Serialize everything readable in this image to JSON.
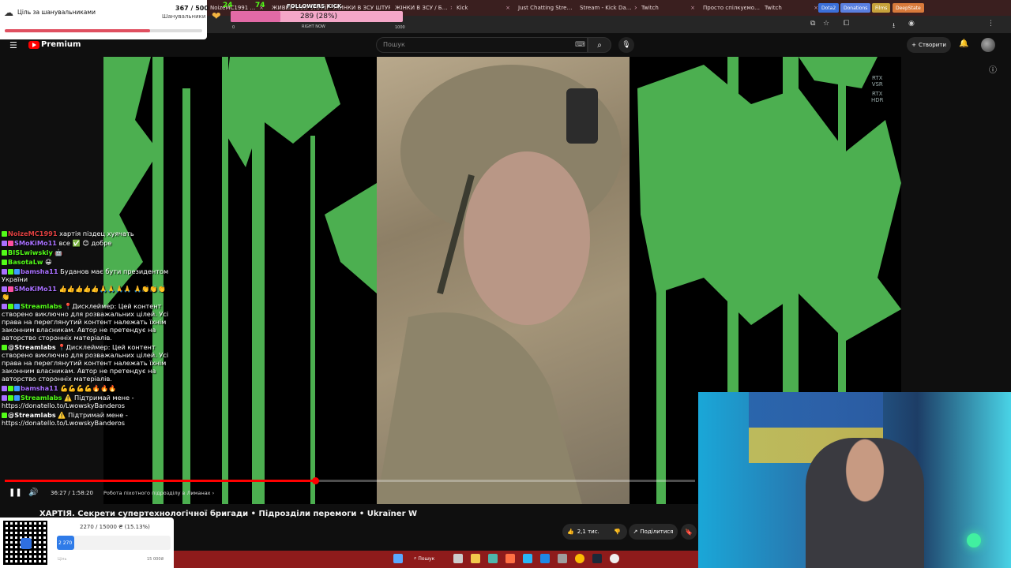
{
  "browser": {
    "tabs": [
      {
        "title": "NoizeMC1991 …",
        "color": "#3a1f1f"
      },
      {
        "title": "ЖИВИЙ ЕФІР УКРАЇНСЬКИЙ ДІ…"
      },
      {
        "title": "ЖИНКИ В ЗСУ ШТУРМ…"
      },
      {
        "title": "ЖІНКИ В ЗСУ / Б…"
      },
      {
        "title": "Kick"
      },
      {
        "title": "Just Chatting Stre…"
      },
      {
        "title": "Stream - Kick Da…"
      },
      {
        "title": "Twitch"
      },
      {
        "title": "Просто спілкуємо…"
      },
      {
        "title": "Twitch"
      }
    ],
    "bookmarks": [
      {
        "label": "Dota2",
        "color": "#3b6fd9"
      },
      {
        "label": "Donations",
        "color": "#5a7fe0"
      },
      {
        "label": "Films",
        "color": "#c8a23b"
      },
      {
        "label": "DeepState",
        "color": "#d97a3b"
      }
    ]
  },
  "youtube": {
    "logo_label": "Premium",
    "search_placeholder": "Пошук",
    "create_label": "Створити",
    "video_title": "ХАРТІЯ. Секрети супертехнологічної бригади • Підрозділи перемоги • Ukraïner W",
    "time": "36:27 / 1:58:20",
    "chapter": "Робота піхотного підрозділу в Лиманах ›",
    "progress_fraction": 0.45,
    "likes": "2,1 тис.",
    "share_label": "Поділитися",
    "rtx_badge": [
      "RTX",
      "VSR",
      "RTX",
      "HDR"
    ]
  },
  "goal_widget": {
    "title": "Ціль за шанувальниками",
    "count": "367 / 500",
    "subtitle": "Шанувальники",
    "progress_fraction": 0.734
  },
  "followers_widget": {
    "title": "FOLLOWERS KICK",
    "count": "289 (28%)",
    "left_label": "0",
    "now_label": "RIGHT NOW",
    "max_label": "1000",
    "progress_fraction": 0.289,
    "stat1": "24",
    "stat2": "74"
  },
  "chat": [
    {
      "user": "NoizeMC1991",
      "user_color": "#e04040",
      "text": "хартія піздец хуячать",
      "badges": [
        "#53fc18"
      ]
    },
    {
      "user": "SMoKiMo11",
      "user_color": "#a970ff",
      "text": "все ✅ 😊 добре",
      "badges": [
        "#a970ff",
        "#ff4fa0"
      ]
    },
    {
      "user": "BISLwiwskiy",
      "user_color": "#53fc18",
      "text": "🤖",
      "badges": [
        "#53fc18"
      ]
    },
    {
      "user": "BasotaLw",
      "user_color": "#53fc18",
      "text": "😀",
      "badges": [
        "#53fc18"
      ]
    },
    {
      "user": "bamsha11",
      "user_color": "#a970ff",
      "text": "Буданов має бути президентом України",
      "badges": [
        "#a970ff",
        "#53fc18",
        "#3b9cff"
      ]
    },
    {
      "user": "SMoKiMo11",
      "user_color": "#a970ff",
      "text": "👍👍👍👍👍🙏🙏🙏🙏 🙏👏👏👏👏",
      "badges": [
        "#a970ff",
        "#ff4fa0"
      ]
    },
    {
      "user": "Streamlabs",
      "user_color": "#53fc18",
      "text": "📍Дисклеймер: Цей контент створено виключно для розважальних цілей. Усі права на переглянутий контент належать їхнім законним власникам. Автор не претендує на авторство сторонніх матеріалів.",
      "badges": [
        "#a970ff",
        "#53fc18",
        "#3b9cff"
      ]
    },
    {
      "user": "@Streamlabs",
      "user_color": "#fff",
      "text": "📍Дисклеймер: Цей контент створено виключно для розважальних цілей. Усі права на переглянутий контент належать їхнім законним власникам. Автор не претендує на авторство сторонніх матеріалів.",
      "badges": [
        "#53fc18"
      ]
    },
    {
      "user": "bamsha11",
      "user_color": "#a970ff",
      "text": "💪💪💪💪🔥🔥🔥",
      "badges": [
        "#a970ff",
        "#53fc18",
        "#3b9cff"
      ]
    },
    {
      "user": "Streamlabs",
      "user_color": "#53fc18",
      "text": "⚠️ Підтримай мене - https://donatello.to/LwowskyBanderos",
      "badges": [
        "#a970ff",
        "#53fc18",
        "#3b9cff"
      ]
    },
    {
      "user": "@Streamlabs",
      "user_color": "#fff",
      "text": "⚠️ Підтримай мене - https://donatello.to/LwowskyBanderos",
      "badges": [
        "#53fc18"
      ]
    }
  ],
  "donation_widget": {
    "amount": "2270 / 15000 ₴ (15.13%)",
    "bar_label": "2 270",
    "min_label": "Ціль",
    "max_label": "15 000₴",
    "progress_fraction": 0.1513
  },
  "taskbar": {
    "search_label": "Пошук"
  }
}
